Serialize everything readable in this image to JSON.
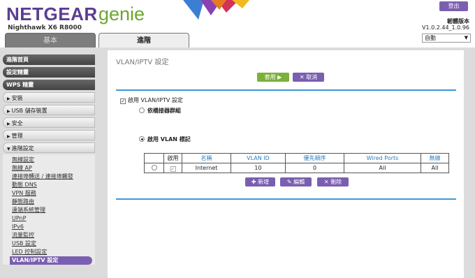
{
  "header": {
    "logo_netgear": "NETGEAR",
    "logo_genie": "genie",
    "model": "Nighthawk X6 R8000",
    "logout_label": "登出",
    "firmware_label": "韌體版本",
    "firmware_version": "V1.0.2.44_1.0.96",
    "language_value": "自動"
  },
  "tabs": {
    "basic": "基本",
    "advanced": "進階"
  },
  "sidebar": {
    "top_items": [
      "進階首頁",
      "設定精靈",
      "WPS 精靈"
    ],
    "sections": [
      "安裝",
      "USB 儲存裝置",
      "安全",
      "管理",
      "進階設定"
    ],
    "sub_items": [
      "無線設定",
      "無線 AP",
      "連接埠轉送 / 連接埠觸發",
      "動態 DNS",
      "VPN 服務",
      "靜態路由",
      "遠端系統管理",
      "UPnP",
      "IPv6",
      "流量監控",
      "USB 設定",
      "LED 控制設定",
      "VLAN/IPTV 設定"
    ]
  },
  "main": {
    "title": "VLAN/IPTV 設定",
    "apply_label": "套用 ▶",
    "cancel_label": "✕ 取消",
    "enable_label": "啟用 VLAN/IPTV 設定",
    "radio_group_label": "依橋接器群組",
    "radio_tag_label": "啟用 VLAN 標記",
    "table": {
      "headers": [
        "",
        "啟用",
        "名稱",
        "VLAN ID",
        "優先順序",
        "Wired Ports",
        "無線"
      ],
      "rows": [
        {
          "name": "Internet",
          "vlan_id": "10",
          "priority": "0",
          "wired_ports": "All",
          "wireless": "All"
        }
      ]
    },
    "add_label": "✚ 新增",
    "edit_label": "✎ 編輯",
    "delete_label": "✕ 刪除"
  },
  "colors": {
    "brand_purple": "#5b3d93",
    "brand_green": "#6da52f",
    "button_purple": "#7a5fb0",
    "apply_green": "#7bb13a",
    "rule_blue": "#3a9ad8"
  }
}
